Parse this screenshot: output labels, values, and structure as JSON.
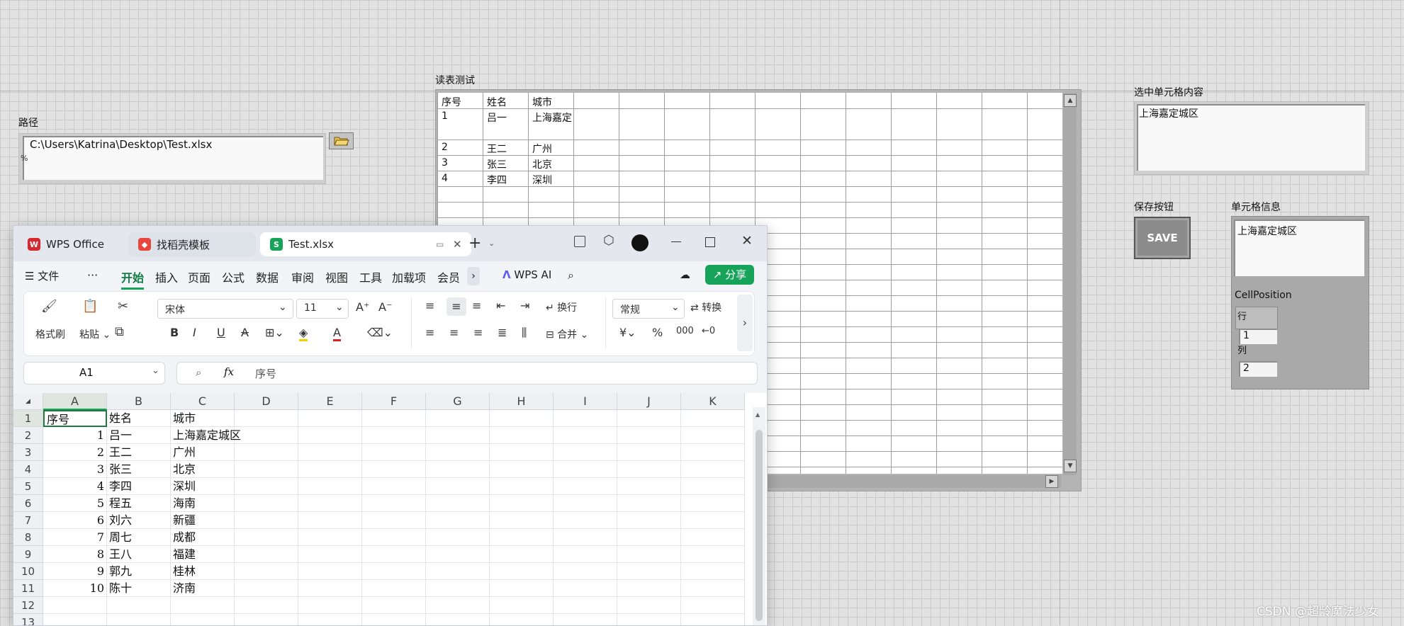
{
  "front_panel": {
    "path_label": "路径",
    "path_value": "C:\\Users\\Katrina\\Desktop\\Test.xlsx",
    "path_mark": "%",
    "table_label": "读表测试",
    "table_rows": [
      [
        "序号",
        "姓名",
        "城市"
      ],
      [
        "1",
        "吕一",
        "上海嘉定"
      ],
      [
        "2",
        "王二",
        "广州"
      ],
      [
        "3",
        "张三",
        "北京"
      ],
      [
        "4",
        "李四",
        "深圳"
      ]
    ],
    "selected_label": "选中单元格内容",
    "selected_value": "上海嘉定城区",
    "save_label": "保存按钮",
    "save_button": "SAVE",
    "cellinfo_label": "单元格信息",
    "cellinfo_value": "上海嘉定城区",
    "cellpos_label": "CellPosition",
    "row_label": "行",
    "row_value": "1",
    "col_label": "列",
    "col_value": "2"
  },
  "wps": {
    "tabs": [
      {
        "label": "WPS Office",
        "icon": "wps-logo-icon"
      },
      {
        "label": "找稻壳模板",
        "icon": "docer-icon"
      },
      {
        "label": "Test.xlsx",
        "icon": "spreadsheet-icon"
      }
    ],
    "menu": {
      "file": "文件",
      "more": "···",
      "items": [
        "开始",
        "插入",
        "页面",
        "公式",
        "数据",
        "审阅",
        "视图",
        "工具",
        "加载项",
        "会员"
      ],
      "active": "开始",
      "ai": "WPS AI",
      "share": "分享"
    },
    "ribbon": {
      "format_painter": "格式刷",
      "paste": "粘贴",
      "font_name": "宋体",
      "font_size": "11",
      "wrap": "换行",
      "number_format": "常规",
      "convert": "转换",
      "merge": "合并"
    },
    "name_box": "A1",
    "fx": "fx",
    "formula_value": "序号",
    "columns": [
      "A",
      "B",
      "C",
      "D",
      "E",
      "F",
      "G",
      "H",
      "I",
      "J",
      "K"
    ],
    "row_numbers": [
      "1",
      "2",
      "3",
      "4",
      "5",
      "6",
      "7",
      "8",
      "9",
      "10",
      "11",
      "12",
      "13"
    ],
    "rows": [
      [
        "序号",
        "姓名",
        "城市"
      ],
      [
        "1",
        "吕一",
        "上海嘉定城区"
      ],
      [
        "2",
        "王二",
        "广州"
      ],
      [
        "3",
        "张三",
        "北京"
      ],
      [
        "4",
        "李四",
        "深圳"
      ],
      [
        "5",
        "程五",
        "海南"
      ],
      [
        "6",
        "刘六",
        "新疆"
      ],
      [
        "7",
        "周七",
        "成都"
      ],
      [
        "8",
        "王八",
        "福建"
      ],
      [
        "9",
        "郭九",
        "桂林"
      ],
      [
        "10",
        "陈十",
        "济南"
      ]
    ]
  },
  "watermark": "CSDN @超龄魔法少女"
}
